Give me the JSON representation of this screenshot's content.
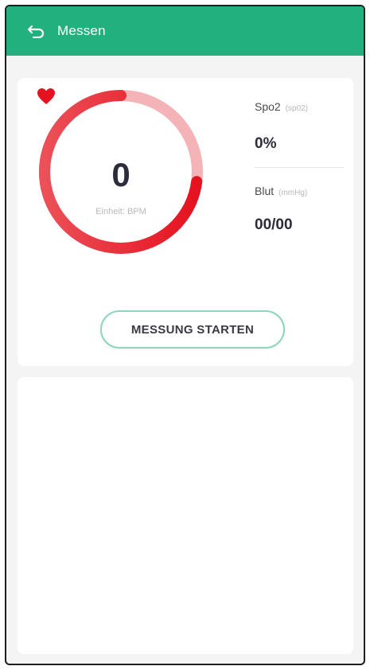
{
  "header": {
    "title": "Messen",
    "back_icon": "back-arrow-icon",
    "color": "#22b07f"
  },
  "heart_rate": {
    "value": "0",
    "unit_label": "Einheit: BPM",
    "icon": "heart-icon",
    "ring_color": "#e8232e",
    "ring_track_color": "#f4b3b7"
  },
  "metrics": {
    "spo2": {
      "label": "Spo2",
      "unit": "(sp02)",
      "value": "0%"
    },
    "blood": {
      "label": "Blut",
      "unit": "(mmHg)",
      "value": "00/00"
    }
  },
  "actions": {
    "start_label": "MESSUNG STARTEN",
    "button_border_color": "#8ed6be"
  }
}
